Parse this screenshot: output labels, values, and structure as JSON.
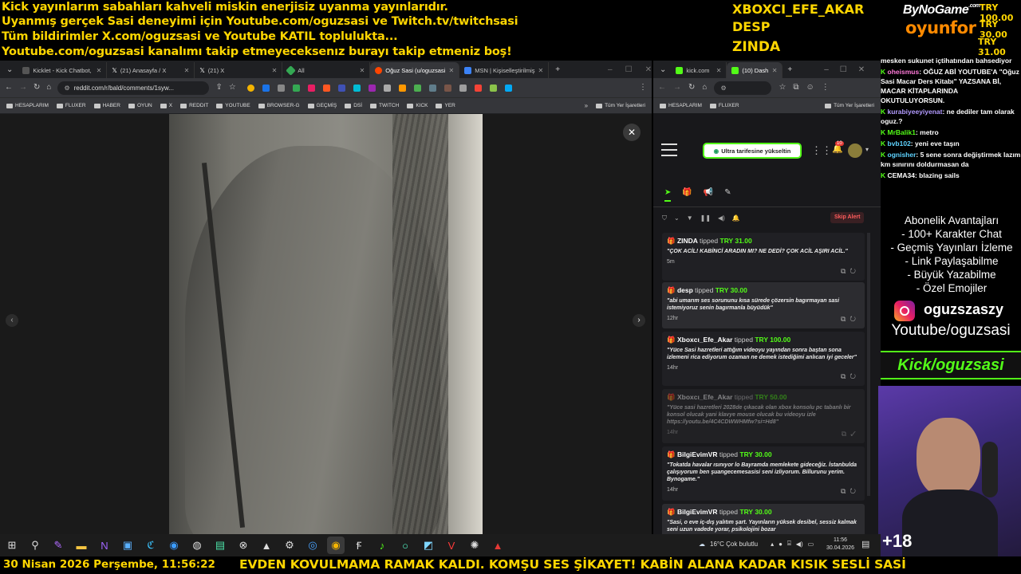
{
  "overlay": {
    "lines": [
      "Kick yayınlarım sabahları kahveli miskin enerjisiz uyanma yayınlarıdır.",
      "Uyanmış gerçek Sasi deneyimi için Youtube.com/oguzsasi ve Twitch.tv/twitchsasi",
      "Tüm bildirimler X.com/oguzsasi ve Youtube KATIL toplulukta...",
      "Youtube.com/oguzsasi kanalımı takip etmeyeceksenız burayı takip etmeniz boş!"
    ],
    "top_donors": [
      "XBOXCI_EFE_AKAR",
      "DESP",
      "ZINDA"
    ],
    "amounts": [
      "TRY 100.00",
      "TRY 30.00",
      "TRY 31.00"
    ],
    "sponsor_top": "ByNoGame",
    "sponsor_com": ".com",
    "sponsor_bottom": "oyunfor"
  },
  "left_browser": {
    "tabs": [
      {
        "label": "Kicklet - Kick Chatbot,",
        "color": "#9aa0a6"
      },
      {
        "label": "(21) Anasayfa / X",
        "color": "#9aa0a6"
      },
      {
        "label": "(21) X",
        "color": "#9aa0a6"
      },
      {
        "label": "All",
        "color": "#34a853"
      },
      {
        "label": "Oğuz Sasi (u/oguzsasi",
        "color": "#ff4500"
      },
      {
        "label": "MSN | Kişiselleştirilmiş",
        "color": "#3b82f6"
      }
    ],
    "url": "reddit.com/r/bald/comments/1syw...",
    "bookmarks": [
      "HESAPLARIM",
      "FLUXER",
      "HABER",
      "OYUN",
      "X",
      "REDDIT",
      "YOUTUBE",
      "BROWSER-G",
      "GEÇMİŞ",
      "DSİ",
      "TWITCH",
      "KICK",
      "YER"
    ],
    "all_bookmarks": "Tüm Yer İşaretleri"
  },
  "right_browser": {
    "tabs": [
      {
        "label": "kick.com",
        "color": "#53fc18"
      },
      {
        "label": "(10) Dash",
        "color": "#53fc18"
      }
    ],
    "bookmarks": [
      "HESAPLARIM",
      "FLUXER"
    ],
    "all_bookmarks": "Tüm Yer İşaretleri",
    "upgrade_button": "Ultra tarifesine yükseltin",
    "notif_count": "10",
    "skip_alert": "Skip Alert",
    "tipped_word": "tipped",
    "donations": [
      {
        "name": "ZINDA",
        "amount": "TRY 31.00",
        "message": "\"ÇOK ACİL! KABİNCİ ARADIN MI? NE DEDİ? ÇOK ACİL AŞIRI ACİL.\"",
        "time": "5m",
        "dim": false
      },
      {
        "name": "desp",
        "amount": "TRY 30.00",
        "message": "\"abi umarım ses sorununu kısa sürede çözersin bagırmayan sasi istemiyoruz senin bagırmanla büyüdük\"",
        "time": "12hr",
        "dim": false
      },
      {
        "name": "Xboxcı_Efe_Akar",
        "amount": "TRY 100.00",
        "message": "\"Yüce Sasi hazretleri attığım videoyu yayından sonra baştan sona izlemeni rica ediyorum ozaman ne demek istediğimi anlıcan iyi geceler\"",
        "time": "14hr",
        "dim": false
      },
      {
        "name": "Xboxcı_Efe_Akar",
        "amount": "TRY 50.00",
        "message": "\"Yüce sasi hazretleri 2028de çıkacak olan xbox konsolu pc tabanlı bir konsol olucak yani klavye mouse olucak bu videoyu izle https://youtu.be/4C4CDWWHMfw?si=Hd8\"",
        "time": "14hr",
        "dim": true
      },
      {
        "name": "BilgiEvimVR",
        "amount": "TRY 30.00",
        "message": "\"Tokatda havalar ısınıyor lo Bayramda memlekete gideceğiz. İstanbulda çalışıyorum ben şuangecemesasisi seni izliyorum. Billurunu yerim. Bynogame.\"",
        "time": "14hr",
        "dim": false
      },
      {
        "name": "BilgiEvimVR",
        "amount": "TRY 30.00",
        "message": "\"Sasi, o eve iç-dış yalıtım şart. Yayınların yüksek desibel, sessiz kalmak seni uzun vadede yorar, psikolojini bozar",
        "time": "",
        "dim": false
      }
    ]
  },
  "chat": [
    {
      "user": "",
      "text": "mesken sukunet içtihatından bahsediyor",
      "color": "#ffffff"
    },
    {
      "user": "oheismus",
      "text": ": OĞUZ ABİ YOUTUBE'A \"Oğuz Sasi Macar Ders Kitabı\" YAZSANA Bİ, MACAR KİTAPLARINDA OKUTULUYORSUN.",
      "color": "#ff7ad9"
    },
    {
      "user": "kurabiyeeyiyenat",
      "text": ": ne dediler tam olarak oguz.?",
      "color": "#b39bff"
    },
    {
      "user": "MrBalik1",
      "text": ": metro",
      "color": "#53fc18"
    },
    {
      "user": "bvb102",
      "text": ": yeni eve taşın",
      "color": "#5fd3ff"
    },
    {
      "user": "ognisher",
      "text": ": 5 sene sonra değiştirmek lazım km sınırını doldurmasan da",
      "color": "#5fd3ff"
    },
    {
      "user": "CEMA34",
      "text": ": blazing sails",
      "color": "#ffffff"
    }
  ],
  "sub_benefits": {
    "title": "Abonelik Avantajları",
    "items": [
      "- 100+ Karakter Chat",
      "- Geçmiş Yayınları İzleme",
      "- Link Paylaşabilme",
      "- Büyük Yazabilme",
      "- Özel Emojiler"
    ]
  },
  "socials": {
    "instagram": "oguzszaszy",
    "youtube": "Youtube/oguzsasi",
    "kick": "Kick/oguzsasi"
  },
  "viewer_extra": "+18",
  "taskbar": {
    "weather": "16°C  Çok bulutlu",
    "time": "11:56",
    "date": "30.04.2026"
  },
  "bottom": {
    "datetime": "30 Nisan 2026 Perşembe, 11:56:22",
    "marquee": "EVDEN KOVULMAMA RAMAK KALDI. KOMŞU SES ŞİKAYET! KABİN ALANA KADAR KISIK SESLİ SASİ"
  }
}
